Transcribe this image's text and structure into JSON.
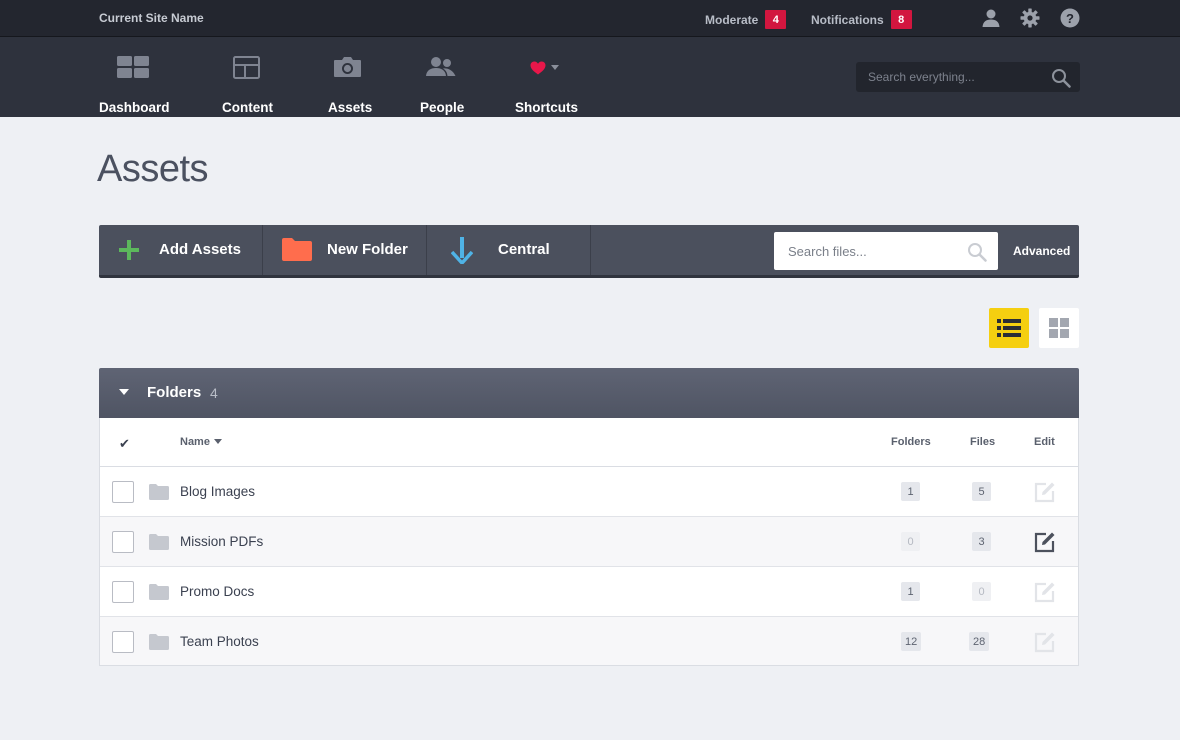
{
  "topbar": {
    "site_name": "Current Site Name",
    "moderate_label": "Moderate",
    "moderate_count": "4",
    "notifications_label": "Notifications",
    "notifications_count": "8"
  },
  "nav": {
    "items": [
      {
        "label": "Dashboard",
        "icon": "dashboard-icon"
      },
      {
        "label": "Content",
        "icon": "layout-icon"
      },
      {
        "label": "Assets",
        "icon": "camera-icon"
      },
      {
        "label": "People",
        "icon": "people-icon"
      },
      {
        "label": "Shortcuts",
        "icon": "heart-icon"
      }
    ],
    "search_placeholder": "Search everything..."
  },
  "page": {
    "title": "Assets"
  },
  "toolbar": {
    "add_label": "Add Assets",
    "new_folder_label": "New Folder",
    "central_label": "Central",
    "search_placeholder": "Search files...",
    "advanced_label": "Advanced"
  },
  "folders": {
    "title": "Folders",
    "count": "4",
    "columns": {
      "name": "Name",
      "folders": "Folders",
      "files": "Files",
      "edit": "Edit"
    },
    "rows": [
      {
        "name": "Blog Images",
        "folders": "1",
        "files": "5"
      },
      {
        "name": "Mission PDFs",
        "folders": "0",
        "files": "3"
      },
      {
        "name": "Promo Docs",
        "folders": "1",
        "files": "0"
      },
      {
        "name": "Team Photos",
        "folders": "12",
        "files": "28"
      }
    ]
  },
  "colors": {
    "accent_yellow": "#f5cf10",
    "badge_red": "#d2163f",
    "add_green": "#5cb85c",
    "folder_orange": "#ff6d4d",
    "arrow_blue": "#4fb3e6",
    "heart_red": "#e8174a"
  }
}
